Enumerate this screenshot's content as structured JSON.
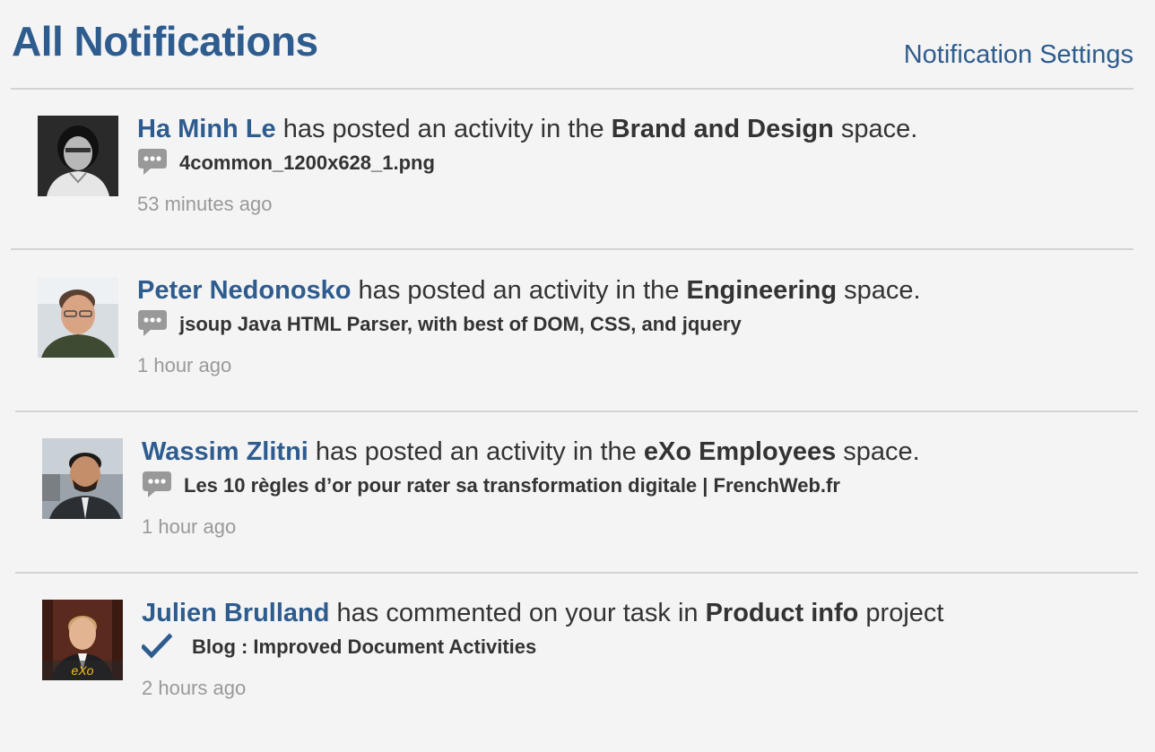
{
  "header": {
    "title": "All Notifications",
    "settings_label": "Notification Settings"
  },
  "colors": {
    "link": "#2e5c8e",
    "text": "#333333",
    "muted": "#999999",
    "divider": "#d3d3d3"
  },
  "notifications": [
    {
      "user": "Ha Minh Le",
      "action": " has posted an activity in the ",
      "target": "Brand and Design",
      "suffix": " space.",
      "icon": "comment-icon",
      "title": "4common_1200x628_1.png",
      "time": "53 minutes ago"
    },
    {
      "user": "Peter Nedonosko",
      "action": " has posted an activity in the ",
      "target": "Engineering",
      "suffix": " space.",
      "icon": "comment-icon",
      "title": "jsoup Java HTML Parser, with best of DOM, CSS, and jquery",
      "time": "1 hour ago"
    },
    {
      "user": "Wassim Zlitni",
      "action": " has posted an activity in the ",
      "target": "eXo Employees",
      "suffix": " space.",
      "icon": "comment-icon",
      "title": "Les 10 règles d’or pour rater sa transformation digitale | FrenchWeb.fr",
      "time": "1 hour ago"
    },
    {
      "user": "Julien Brulland",
      "action": " has commented on your task in ",
      "target": "Product info",
      "suffix": " project",
      "icon": "checkmark-icon",
      "title": "Blog : Improved Document Activities",
      "time": "2 hours ago",
      "avatar_badge": "eXo"
    }
  ]
}
